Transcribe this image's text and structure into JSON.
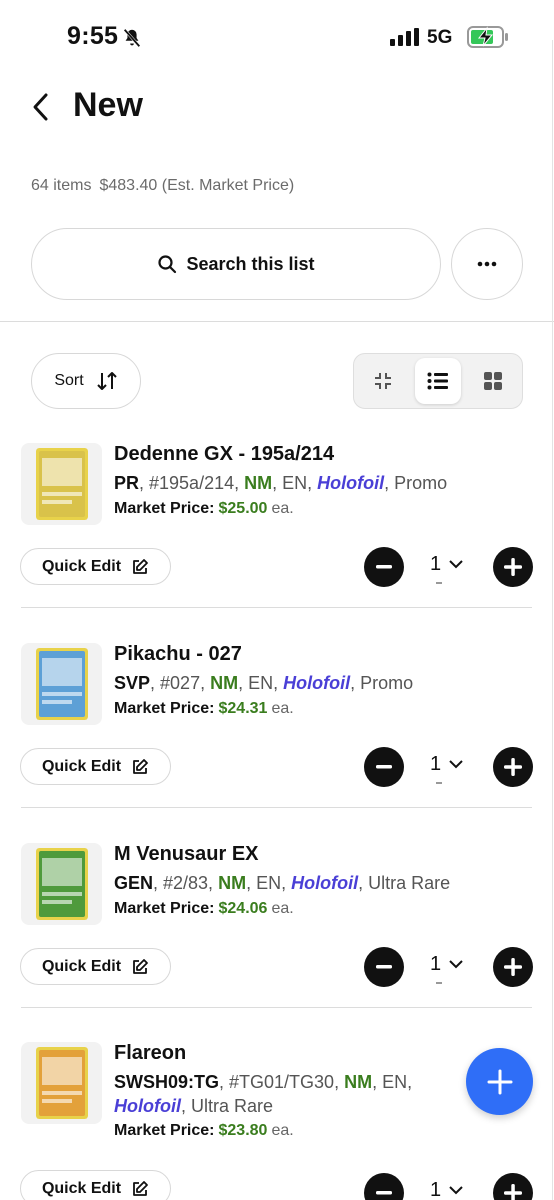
{
  "status": {
    "time": "9:55",
    "network": "5G"
  },
  "header": {
    "title": "New"
  },
  "summary": {
    "count": "64 items",
    "value": "$483.40 (Est. Market Price)"
  },
  "search": {
    "label": "Search this list"
  },
  "toolbar": {
    "sort_label": "Sort",
    "active_view": "list"
  },
  "items": [
    {
      "name": "Dedenne GX - 195a/214",
      "set": "PR",
      "number": ", #195a/214, ",
      "condition": "NM",
      "lang": ", EN, ",
      "finish": "Holofoil",
      "rarity": ", Promo",
      "market_label": "Market Price:",
      "price": "$25.00",
      "ea": "ea.",
      "quick_edit": "Quick Edit",
      "qty": "1",
      "art_color": "#d9c24a"
    },
    {
      "name": "Pikachu - 027",
      "set": "SVP",
      "number": ", #027, ",
      "condition": "NM",
      "lang": ", EN, ",
      "finish": "Holofoil",
      "rarity": ", Promo",
      "market_label": "Market Price:",
      "price": "$24.31",
      "ea": "ea.",
      "quick_edit": "Quick Edit",
      "qty": "1",
      "art_color": "#5da0d6"
    },
    {
      "name": "M Venusaur EX",
      "set": "GEN",
      "number": ", #2/83, ",
      "condition": "NM",
      "lang": ", EN, ",
      "finish": "Holofoil",
      "rarity": ", Ultra Rare",
      "market_label": "Market Price:",
      "price": "$24.06",
      "ea": "ea.",
      "quick_edit": "Quick Edit",
      "qty": "1",
      "art_color": "#4f9a3c"
    },
    {
      "name": "Flareon",
      "set": "SWSH09:TG",
      "number": ", #TG01/TG30, ",
      "condition": "NM",
      "lang": ", EN,",
      "finish": "Holofoil",
      "rarity": ", Ultra Rare",
      "market_label": "Market Price:",
      "price": "$23.80",
      "ea": "ea.",
      "quick_edit": "Quick Edit",
      "qty": "1",
      "art_color": "#e3a13a"
    }
  ],
  "colors": {
    "accent": "#2f6ef7",
    "condition": "#3a7d1e",
    "foil": "#4a3fd6",
    "price": "#3a7d1e"
  }
}
